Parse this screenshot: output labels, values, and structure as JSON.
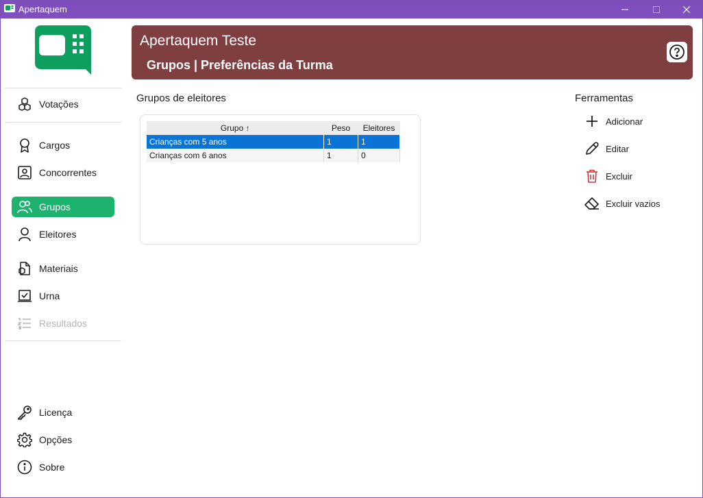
{
  "window": {
    "title": "Apertaquem",
    "controls": [
      "minimize-icon",
      "maximize-icon",
      "close-icon"
    ],
    "accent": "#7e4fbd"
  },
  "sidebar": {
    "items": [
      {
        "label": "Votações",
        "icon": "cubes-icon"
      },
      {
        "label": "Cargos",
        "icon": "award-icon"
      },
      {
        "label": "Concorrentes",
        "icon": "contact-card-icon"
      },
      {
        "label": "Grupos",
        "icon": "people-icon",
        "active": true
      },
      {
        "label": "Eleitores",
        "icon": "person-icon"
      },
      {
        "label": "Materiais",
        "icon": "document-box-icon"
      },
      {
        "label": "Urna",
        "icon": "ballot-check-icon"
      },
      {
        "label": "Resultados",
        "icon": "list-icon",
        "disabled": true
      },
      {
        "label": "Licença",
        "icon": "key-icon"
      },
      {
        "label": "Opções",
        "icon": "gear-icon"
      },
      {
        "label": "Sobre",
        "icon": "info-icon"
      }
    ],
    "active_color": "#1db36f"
  },
  "header": {
    "app_name": "Apertaquem Teste",
    "page_title": "Grupos | Preferências da Turma",
    "background": "#7f3e40"
  },
  "groups": {
    "section_title": "Grupos de eleitores",
    "columns": [
      "Grupo ↑",
      "Peso",
      "Eleitores"
    ],
    "rows": [
      {
        "name": "Crianças com 5 anos",
        "peso": "1",
        "eleitores": "1",
        "selected": true
      },
      {
        "name": "Crianças com 6 anos",
        "peso": "1",
        "eleitores": "0",
        "selected": false
      }
    ]
  },
  "tools": {
    "title": "Ferramentas",
    "items": [
      {
        "label": "Adicionar",
        "icon": "plus-icon"
      },
      {
        "label": "Editar",
        "icon": "pencil-icon"
      },
      {
        "label": "Excluir",
        "icon": "trash-icon",
        "color": "#c9383b"
      },
      {
        "label": "Excluir vazios",
        "icon": "eraser-icon"
      }
    ]
  }
}
